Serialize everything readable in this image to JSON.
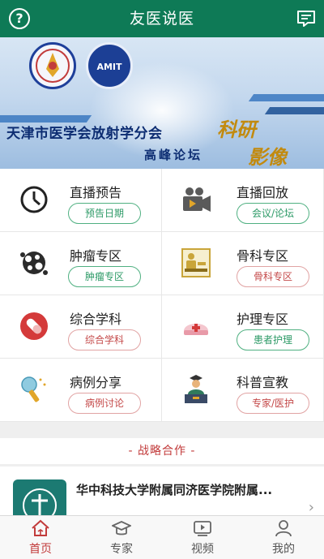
{
  "header": {
    "title": "友医说医"
  },
  "banner": {
    "heading": "天津市医学会放射学分会",
    "subtitle": "高峰论坛",
    "calligraphy_1": "科研",
    "calligraphy_2": "影像",
    "logo_right_text": "AMIT"
  },
  "grid": [
    {
      "label": "直播预告",
      "button": "预告日期",
      "icon": "clock-icon",
      "style": "green"
    },
    {
      "label": "直播回放",
      "button": "会议/论坛",
      "icon": "video-camera-icon",
      "style": "green"
    },
    {
      "label": "肿瘤专区",
      "button": "肿瘤专区",
      "icon": "tumor-cell-icon",
      "style": "green"
    },
    {
      "label": "骨科专区",
      "button": "骨科专区",
      "icon": "orthopedics-icon",
      "style": "red"
    },
    {
      "label": "综合学科",
      "button": "综合学科",
      "icon": "pill-icon",
      "style": "red"
    },
    {
      "label": "护理专区",
      "button": "患者护理",
      "icon": "nurse-cap-icon",
      "style": "green"
    },
    {
      "label": "病例分享",
      "button": "病例讨论",
      "icon": "microphone-icon",
      "style": "red"
    },
    {
      "label": "科普宣教",
      "button": "专家/医护",
      "icon": "lecturer-icon",
      "style": "red"
    }
  ],
  "partners": {
    "title": "- 战略合作 -",
    "items": [
      {
        "name": "华中科技大学附属同济医学院附属..."
      }
    ]
  },
  "nav": [
    {
      "label": "首页",
      "icon": "home-icon",
      "active": true
    },
    {
      "label": "专家",
      "icon": "graduation-cap-icon",
      "active": false
    },
    {
      "label": "视频",
      "icon": "play-icon",
      "active": false
    },
    {
      "label": "我的",
      "icon": "user-icon",
      "active": false
    }
  ],
  "colors": {
    "primary": "#0e7a56",
    "accent_red": "#c23b3b",
    "button_green": "#2d9a67"
  }
}
